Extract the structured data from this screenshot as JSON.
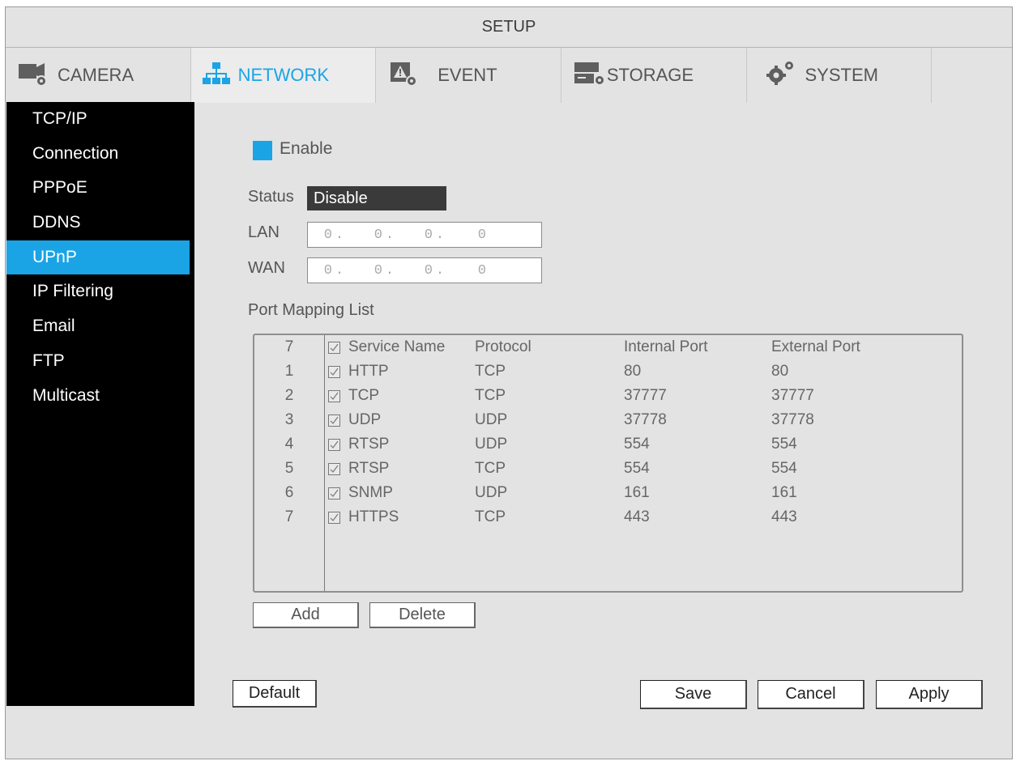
{
  "title": "SETUP",
  "tabs": [
    {
      "label": "CAMERA",
      "icon": "camera-gear-icon",
      "active": false
    },
    {
      "label": "NETWORK",
      "icon": "network-icon",
      "active": true
    },
    {
      "label": "EVENT",
      "icon": "event-warning-icon",
      "active": false
    },
    {
      "label": "STORAGE",
      "icon": "storage-icon",
      "active": false
    },
    {
      "label": "SYSTEM",
      "icon": "system-gears-icon",
      "active": false
    }
  ],
  "sidebar": {
    "items": [
      "TCP/IP",
      "Connection",
      "PPPoE",
      "DDNS",
      "UPnP",
      "IP Filtering",
      "Email",
      "FTP",
      "Multicast"
    ],
    "active_index": 4
  },
  "form": {
    "enable_label": "Enable",
    "enable_checked": true,
    "status_label": "Status",
    "status_value": "Disable",
    "lan_label": "LAN",
    "lan_value": [
      "0",
      "0",
      "0",
      "0"
    ],
    "wan_label": "WAN",
    "wan_value": [
      "0",
      "0",
      "0",
      "0"
    ],
    "port_mapping_label": "Port Mapping List"
  },
  "table": {
    "header": {
      "count": "7",
      "service_name": "Service Name",
      "protocol": "Protocol",
      "internal_port": "Internal Port",
      "external_port": "External Port"
    },
    "rows": [
      {
        "idx": "1",
        "name": "HTTP",
        "protocol": "TCP",
        "internal": "80",
        "external": "80"
      },
      {
        "idx": "2",
        "name": "TCP",
        "protocol": "TCP",
        "internal": "37777",
        "external": "37777"
      },
      {
        "idx": "3",
        "name": "UDP",
        "protocol": "UDP",
        "internal": "37778",
        "external": "37778"
      },
      {
        "idx": "4",
        "name": "RTSP",
        "protocol": "UDP",
        "internal": "554",
        "external": "554"
      },
      {
        "idx": "5",
        "name": "RTSP",
        "protocol": "TCP",
        "internal": "554",
        "external": "554"
      },
      {
        "idx": "6",
        "name": "SNMP",
        "protocol": "UDP",
        "internal": "161",
        "external": "161"
      },
      {
        "idx": "7",
        "name": "HTTPS",
        "protocol": "TCP",
        "internal": "443",
        "external": "443"
      }
    ]
  },
  "buttons": {
    "add": "Add",
    "delete": "Delete",
    "default": "Default",
    "save": "Save",
    "cancel": "Cancel",
    "apply": "Apply"
  },
  "colors": {
    "accent": "#1aa4e6",
    "sidebar_bg": "#000000",
    "panel_bg": "#e3e3e3"
  }
}
